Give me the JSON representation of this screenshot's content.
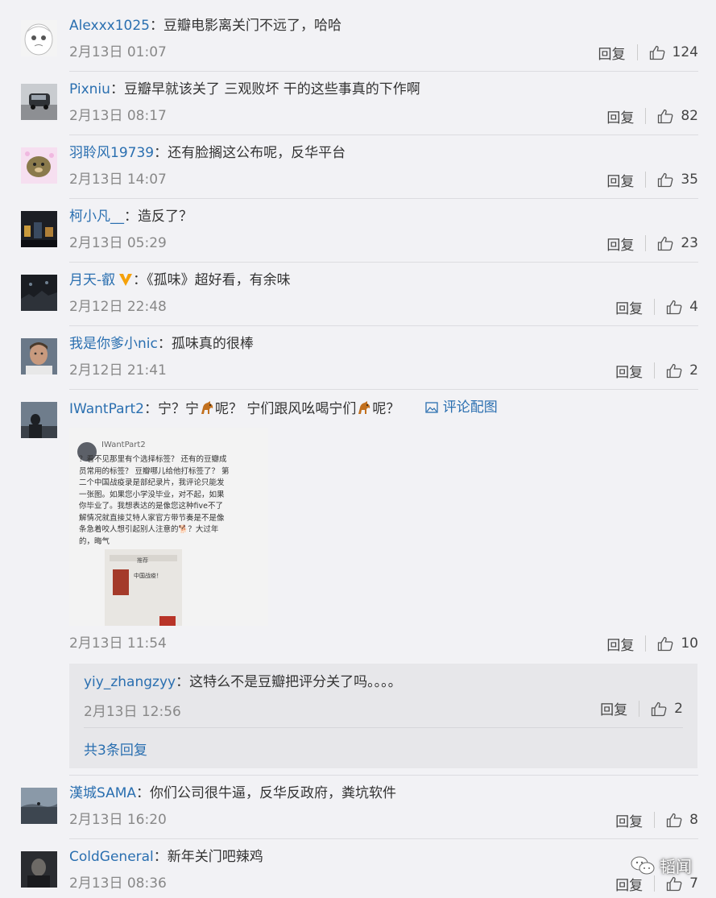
{
  "reply_label": "回复",
  "comments": [
    {
      "user": "Alexxx1025",
      "text": "豆瓣电影离关门不远了，哈哈",
      "time": "2月13日 01:07",
      "likes": "124",
      "avatar_icon": "cartoon-face"
    },
    {
      "user": "Pixniu",
      "text": "豆瓣早就该关了 三观败坏 干的这些事真的下作啊",
      "time": "2月13日 08:17",
      "likes": "82",
      "avatar_icon": "car-photo"
    },
    {
      "user": "羽聆风19739",
      "text": "还有脸搁这公布呢，反华平台",
      "time": "2月13日 14:07",
      "likes": "35",
      "avatar_icon": "plush-toy"
    },
    {
      "user": "柯小凡__",
      "text": "造反了？",
      "time": "2月13日 05:29",
      "likes": "23",
      "avatar_icon": "night-scene"
    },
    {
      "user": "月天-叡",
      "text": "《孤味》超好看，有余味",
      "time": "2月12日 22:48",
      "likes": "4",
      "avatar_icon": "concert-scene",
      "vip": true
    },
    {
      "user": "我是你爹小nic",
      "text": "孤味真的很棒",
      "time": "2月12日 21:41",
      "likes": "2",
      "avatar_icon": "man-portrait"
    },
    {
      "user": "IWantPart2",
      "text_parts": [
        "宁？宁",
        "呢？ 宁们跟风吆喝宁们",
        "呢？"
      ],
      "pic_label": "评论配图",
      "time": "2月13日 11:54",
      "likes": "10",
      "avatar_icon": "person-silhouette"
    },
    {
      "user": "漢城SAMA",
      "text": "你们公司很牛逼，反华反政府，粪坑软件",
      "time": "2月13日 16:20",
      "likes": "8",
      "avatar_icon": "landscape"
    },
    {
      "user": "ColdGeneral",
      "text": "新年关门吧辣鸡",
      "time": "2月13日 08:36",
      "likes": "7",
      "avatar_icon": "dark-portrait"
    }
  ],
  "sub_reply": {
    "user": "yiy_zhangzyy",
    "text": "这特么不是豆瓣把评分关了吗。。。。",
    "time": "2月13日 12:56",
    "likes": "2"
  },
  "more_replies_label": "共3条回复",
  "attached_image": {
    "username": "IWantPart2",
    "lines": [
      "？看不见那里有个选择标签？ 还有的豆瓣成",
      "员常用的标签？ 豆瓣哪儿给他打标签了？ 第",
      "二个中国战疫录是部纪录片，我评论只能发",
      "一张图。如果您小学没毕业，对不起，如果",
      "你毕业了。我想表达的是像您这种five不了",
      "解情况就直接艾特人家官方带节奏是不是像",
      "条急着咬人想引起别人注意的🐕？大过年",
      "的，晦气"
    ],
    "card_title": "中国战疫！",
    "phone_nav": "推荐"
  },
  "watermark": "韬闻",
  "colors": {
    "link": "#2a6fb0",
    "background": "#f2f2f5",
    "time": "#888888"
  }
}
